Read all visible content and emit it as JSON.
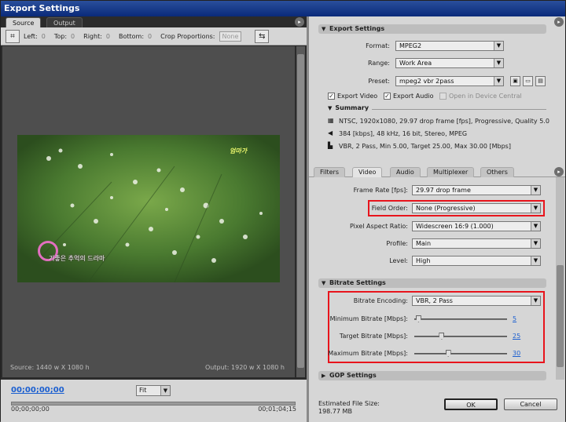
{
  "window": {
    "title": "Export Settings"
  },
  "left_panel": {
    "tabs": [
      {
        "label": "Source"
      },
      {
        "label": "Output"
      }
    ],
    "crop": {
      "left_label": "Left:",
      "left_value": "0",
      "top_label": "Top:",
      "top_value": "0",
      "right_label": "Right:",
      "right_value": "0",
      "bottom_label": "Bottom:",
      "bottom_value": "0",
      "proportions_label": "Crop Proportions:",
      "proportions_value": "None"
    },
    "video_overlay": {
      "top_text": "엄마가",
      "bottom_text": "기좋은 추억의 드라마"
    },
    "source_info": "Source: 1440 w X 1080 h",
    "output_info": "Output: 1920 w X 1080 h",
    "timeline": {
      "current_timecode": "00;00;00;00",
      "fit_value": "Fit",
      "start_timecode": "00;00;00;00",
      "end_timecode": "00;01;04;15"
    }
  },
  "export_settings": {
    "header": "Export Settings",
    "format_label": "Format:",
    "format_value": "MPEG2",
    "range_label": "Range:",
    "range_value": "Work Area",
    "preset_label": "Preset:",
    "preset_value": "mpeg2 vbr 2pass",
    "export_video_label": "Export Video",
    "export_audio_label": "Export Audio",
    "open_device_central_label": "Open in Device Central",
    "summary_header": "Summary",
    "summary_lines": [
      "NTSC, 1920x1080, 29.97 drop frame [fps], Progressive, Quality 5.0",
      "384 [kbps], 48 kHz, 16 bit, Stereo, MPEG",
      "VBR, 2 Pass, Min 5.00, Target 25.00, Max 30.00 [Mbps]"
    ]
  },
  "settings_tabs": [
    {
      "label": "Filters"
    },
    {
      "label": "Video"
    },
    {
      "label": "Audio"
    },
    {
      "label": "Multiplexer"
    },
    {
      "label": "Others"
    }
  ],
  "video": {
    "frame_rate_label": "Frame Rate [fps]:",
    "frame_rate_value": "29.97 drop frame",
    "field_order_label": "Field Order:",
    "field_order_value": "None (Progressive)",
    "pixel_aspect_label": "Pixel Aspect Ratio:",
    "pixel_aspect_value": "Widescreen 16:9 (1.000)",
    "profile_label": "Profile:",
    "profile_value": "Main",
    "level_label": "Level:",
    "level_value": "High"
  },
  "bitrate": {
    "header": "Bitrate Settings",
    "encoding_label": "Bitrate Encoding:",
    "encoding_value": "VBR, 2 Pass",
    "minimum_label": "Minimum Bitrate [Mbps]:",
    "minimum_value": "5",
    "target_label": "Target Bitrate [Mbps]:",
    "target_value": "25",
    "maximum_label": "Maximum Bitrate [Mbps]:",
    "maximum_value": "30",
    "min_level": 0.05,
    "target_level": 0.3,
    "max_level": 0.37
  },
  "gop": {
    "header": "GOP Settings"
  },
  "footer": {
    "estimated_label": "Estimated File Size:",
    "estimated_value": "198.77 MB",
    "ok_label": "OK",
    "cancel_label": "Cancel"
  },
  "colors": {
    "highlight": "#e8141c",
    "link": "#1b5fd0",
    "title_bar": "#0a2a7a"
  }
}
